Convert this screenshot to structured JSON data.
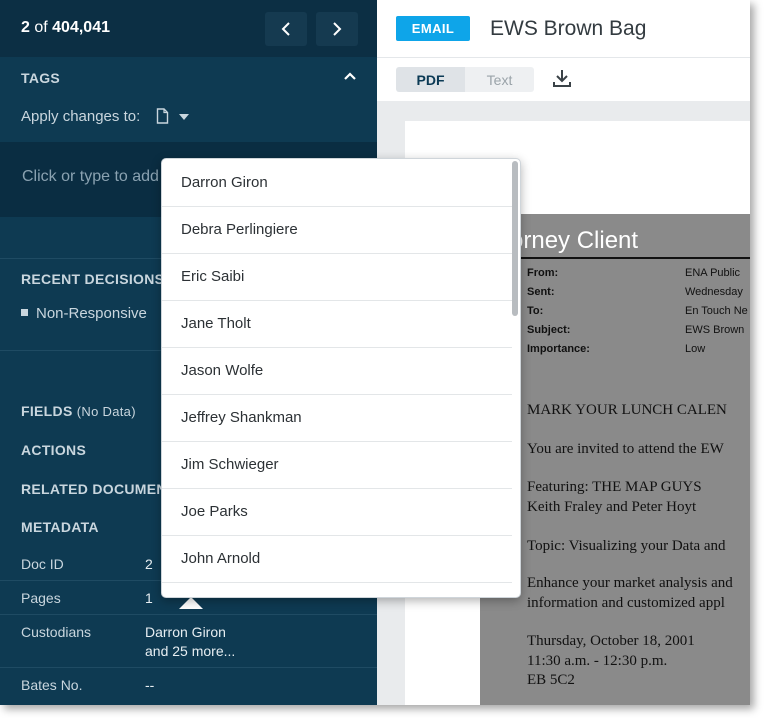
{
  "pager": {
    "current": "2",
    "of": "of",
    "total": "404,041"
  },
  "tags": {
    "title": "TAGS",
    "apply_label": "Apply changes to:",
    "input_placeholder": "Click or type to add"
  },
  "recent_decisions": {
    "title": "RECENT DECISIONS",
    "items": [
      "Non-Responsive"
    ]
  },
  "fields": {
    "title": "FIELDS",
    "note": "(No Data)"
  },
  "actions_title": "ACTIONS",
  "related_title": "RELATED DOCUMENTS",
  "metadata": {
    "title": "METADATA",
    "rows": [
      {
        "label": "Doc ID",
        "value": "2"
      },
      {
        "label": "Pages",
        "value": "1"
      },
      {
        "label": "Custodians",
        "value": "Darron Giron",
        "value2": "and 25 more..."
      },
      {
        "label": "Bates No.",
        "value": "--"
      }
    ]
  },
  "document": {
    "badge": "EMAIL",
    "title": "EWS Brown Bag",
    "view_tabs": [
      "PDF",
      "Text"
    ],
    "active_tab": "PDF"
  },
  "scan": {
    "heading": "orney Client",
    "headers": [
      {
        "label": "From:",
        "value": "ENA Public"
      },
      {
        "label": "Sent:",
        "value": "Wednesday"
      },
      {
        "label": "To:",
        "value": "En Touch Ne"
      },
      {
        "label": "Subject:",
        "value": "EWS Brown"
      },
      {
        "label": "Importance:",
        "value": "Low"
      }
    ],
    "body": [
      "MARK YOUR LUNCH CALEN",
      "You are invited to attend the EW",
      "Featuring:  THE MAP GUYS",
      "Keith Fraley and Peter Hoyt",
      "Topic:  Visualizing your Data and",
      "Enhance your market analysis and",
      "information and customized appl",
      "Thursday, October 18, 2001",
      "11:30 a.m. - 12:30 p.m.",
      "EB 5C2"
    ]
  },
  "custodian_dropdown": {
    "items": [
      "Darron Giron",
      "Debra Perlingiere",
      "Eric Saibi",
      "Jane Tholt",
      "Jason Wolfe",
      "Jeffrey Shankman",
      "Jim Schwieger",
      "Joe Parks",
      "John Arnold"
    ]
  },
  "colors": {
    "sidebar": "#0e3a52",
    "accent": "#0ea5e9",
    "scan_gray": "#8a8a8a"
  }
}
